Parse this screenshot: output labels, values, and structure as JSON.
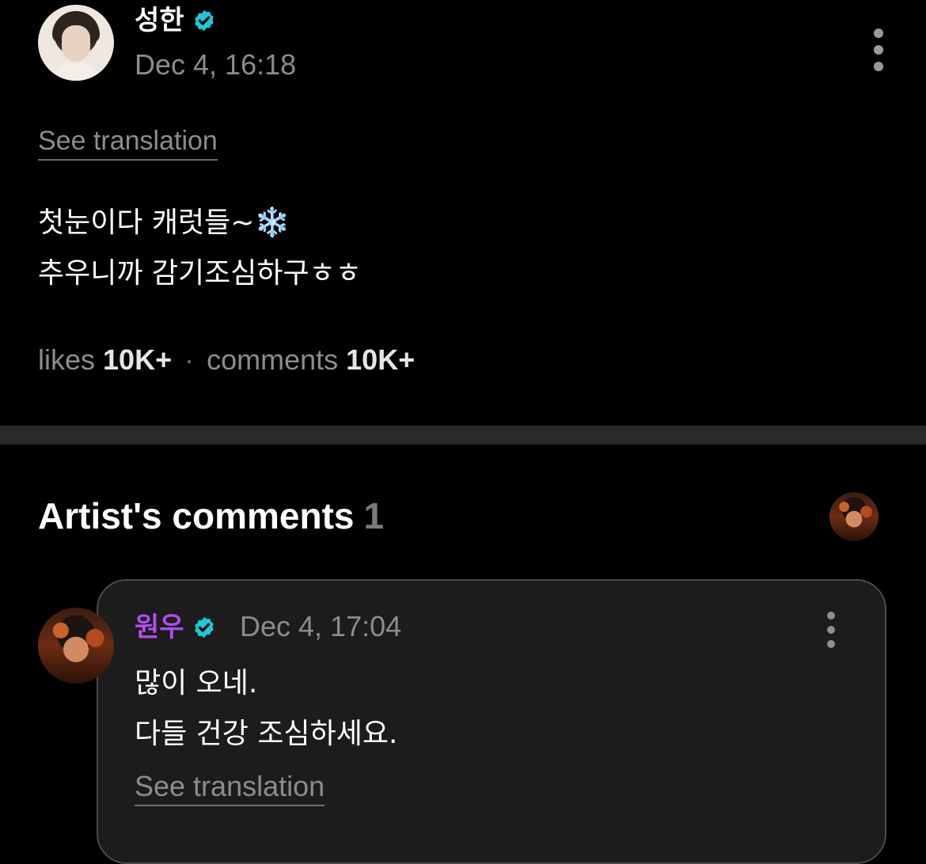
{
  "post": {
    "author": "성한",
    "timestamp": "Dec 4, 16:18",
    "see_translation": "See translation",
    "body_lines": [
      "첫눈이다 캐럿들~❄️",
      "추우니까 감기조심하구ㅎㅎ"
    ],
    "likes_label": "likes",
    "likes_value": "10K+",
    "separator": "·",
    "comments_label": "comments",
    "comments_value": "10K+"
  },
  "artist_comments": {
    "title": "Artist's comments",
    "count": "1",
    "comment": {
      "author": "원우",
      "timestamp": "Dec 4, 17:04",
      "body_lines": [
        "많이 오네.",
        "다들 건강 조심하세요."
      ],
      "see_translation": "See translation"
    }
  },
  "icons": {
    "verified": "verified-badge-icon",
    "more": "more-vertical-icon"
  },
  "colors": {
    "background": "#000000",
    "verified": "#1ec8d6",
    "artist_name": "#b44cf0",
    "secondary_text": "#8c8c8c"
  }
}
